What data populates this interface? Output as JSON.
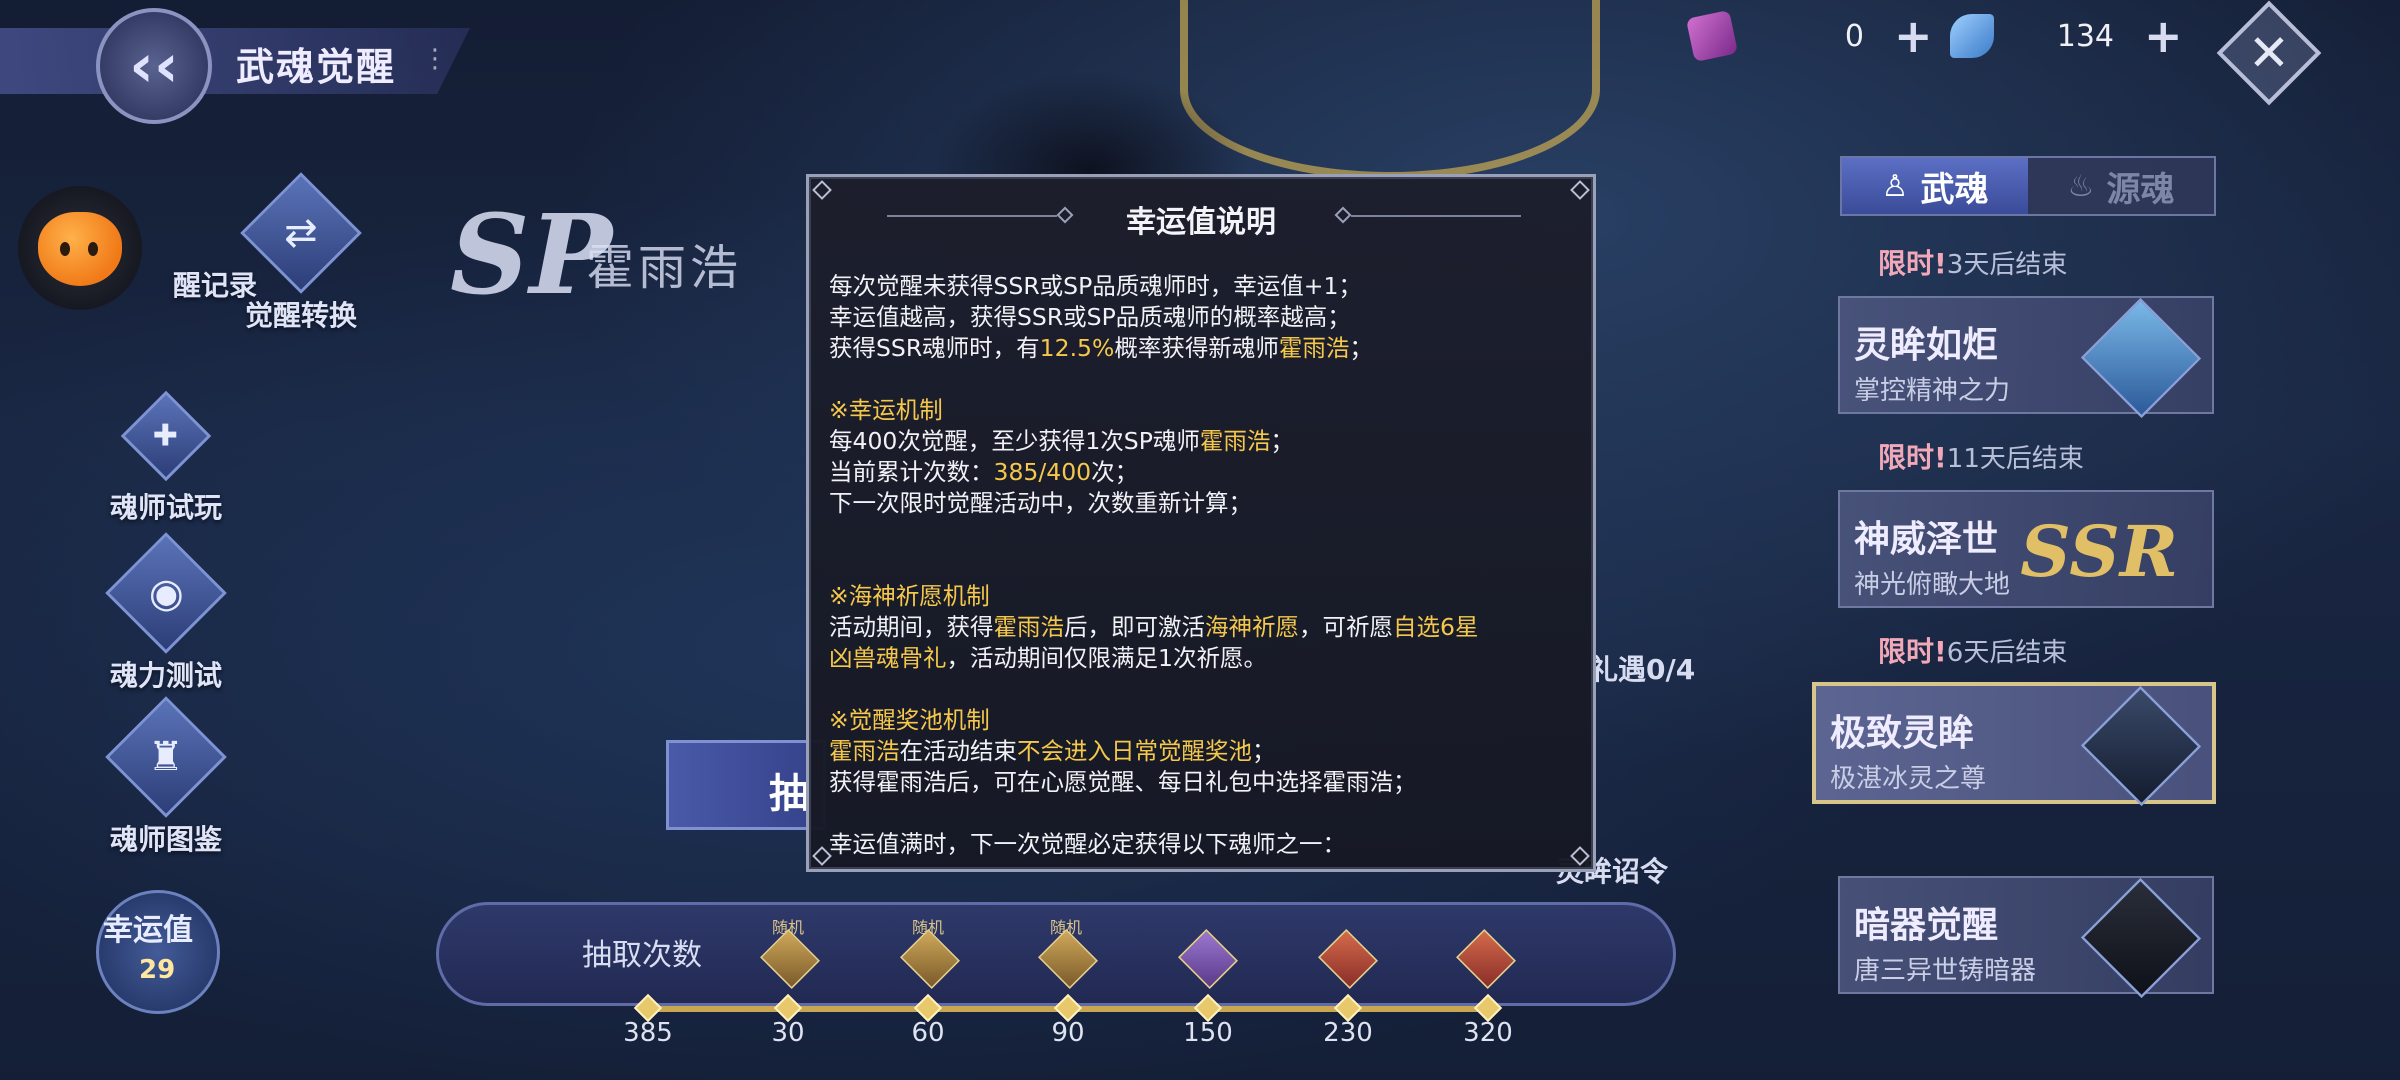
{
  "header": {
    "title": "武魂觉醒",
    "menu_icon": "more-vertical-icon",
    "currency": [
      {
        "icon": "ticket-icon",
        "value": "0",
        "color": "#b04ab0"
      },
      {
        "icon": "diamond-icon",
        "value": "134",
        "color": "#5aa0e0"
      }
    ]
  },
  "left_menu": {
    "record_label": "醒记录",
    "convert_label": "觉醒转换",
    "trial_label": "魂师试玩",
    "power_test_label": "魂力测试",
    "gallery_label": "魂师图鉴",
    "luck": {
      "label": "幸运值",
      "value": "29"
    }
  },
  "hero": {
    "logo": "SP",
    "name": "霍雨浩"
  },
  "tabs": [
    {
      "label": "武魂",
      "icon": "soul-icon",
      "active": true
    },
    {
      "label": "源魂",
      "icon": "flame-icon",
      "active": false
    }
  ],
  "banners": [
    {
      "limit_prefix": "限时!",
      "limit_text": "3天后结束",
      "title": "灵眸如炬",
      "subtitle": "掌控精神之力"
    },
    {
      "limit_prefix": "限时!",
      "limit_text": "11天后结束",
      "title": "神威泽世",
      "subtitle": "神光俯瞰大地",
      "badge": "SSR"
    },
    {
      "limit_prefix": "限时!",
      "limit_text": "6天后结束",
      "title": "极致灵眸",
      "subtitle": "极湛冰灵之尊"
    },
    {
      "title": "暗器觉醒",
      "subtitle": "唐三异世铸暗器"
    }
  ],
  "side_text": {
    "gift": "礼遇0/4",
    "order": "灵眸诏令",
    "draw": "抽"
  },
  "progress": {
    "label": "抽取次数",
    "current": "385",
    "random_tag": "随机",
    "milestones": [
      "30",
      "60",
      "90",
      "150",
      "230",
      "320"
    ]
  },
  "modal": {
    "title": "幸运值说明",
    "lines": {
      "l1": "每次觉醒未获得SSR或SP品质魂师时，幸运值+1；",
      "l2": "幸运值越高，获得SSR或SP品质魂师的概率越高；",
      "l3a": "获得SSR魂师时，有",
      "l3b": "12.5%",
      "l3c": "概率获得新魂师",
      "l3d": "霍雨浩",
      "l3e": "；",
      "s1": "※幸运机制",
      "l4a": "每400次觉醒，至少获得1次SP魂师",
      "l4b": "霍雨浩",
      "l4c": "；",
      "l5a": "当前累计次数：",
      "l5b": "385/400",
      "l5c": "次；",
      "l6": "下一次限时觉醒活动中，次数重新计算；",
      "s2": "※海神祈愿机制",
      "l7a": "活动期间，获得",
      "l7b": "霍雨浩",
      "l7c": "后，即可激活",
      "l7d": "海神祈愿",
      "l7e": "，可祈愿",
      "l7f": "自选6星",
      "l8a": "凶兽魂骨礼",
      "l8b": "，活动期间仅限满足1次祈愿。",
      "s3": "※觉醒奖池机制",
      "l9a": "霍雨浩",
      "l9b": "在活动结束",
      "l9c": "不会进入日常觉醒奖池",
      "l9d": "；",
      "l10": "获得霍雨浩后，可在心愿觉醒、每日礼包中选择霍雨浩；",
      "l11": "幸运值满时，下一次觉醒必定获得以下魂师之一："
    }
  }
}
